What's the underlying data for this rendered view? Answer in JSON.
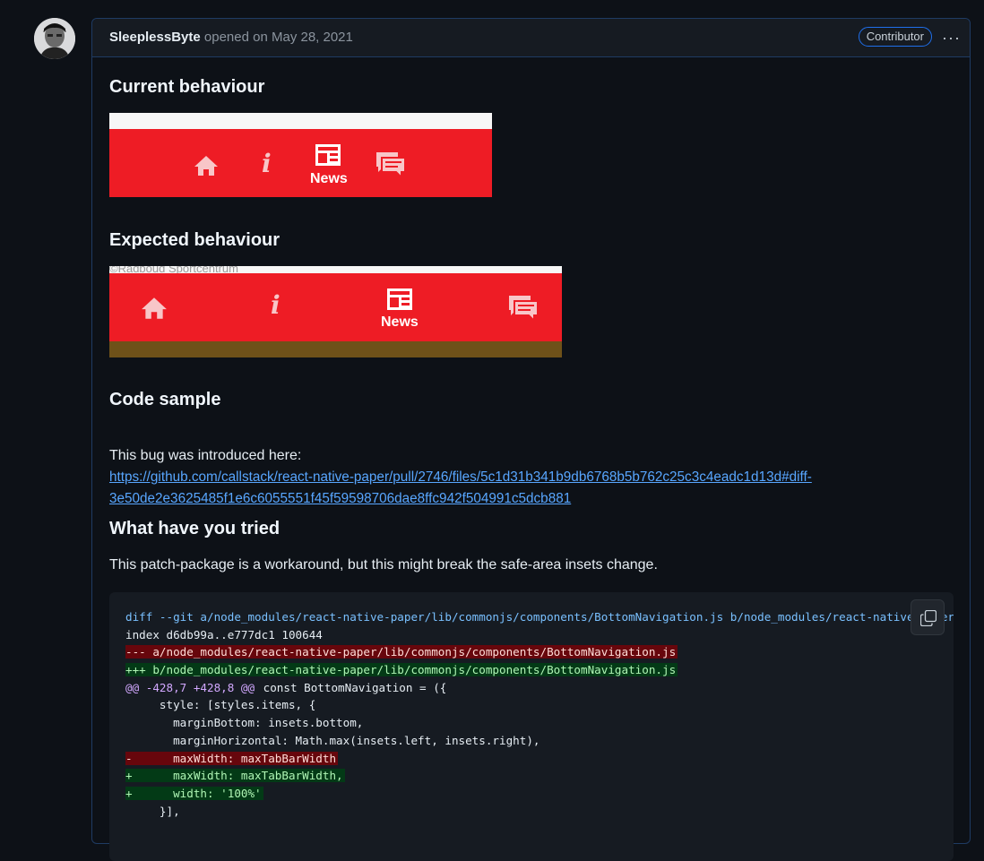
{
  "comment": {
    "author": "SleeplessByte",
    "action_text": " opened on May 28, 2021",
    "badge": "Contributor",
    "menu_glyph": "···"
  },
  "sections": {
    "current": "Current behaviour",
    "expected": "Expected behaviour",
    "code_sample": "Code sample",
    "tried": "What have you tried"
  },
  "screenshots": {
    "news_label": "News",
    "info_glyph": "i",
    "watermark": "©Radboud Sportcentrum",
    "brand_red": "#ee1c25"
  },
  "paragraphs": {
    "introduced": "This bug was introduced here:",
    "link_line1": "https://github.com/callstack/react-native-paper/pull/2746/files/5c1d31b341b9db6768b5b762c25c3c4eadc1d13d#diff-",
    "link_line2": "3e50de2e3625485f1e6c6055551f45f59598706dae8ffc942f504991c5dcb881",
    "workaround": "This patch-package is a workaround, but this might break the safe-area insets change."
  },
  "code": {
    "lines": [
      {
        "kind": "meta",
        "text": "diff --git a/node_modules/react-native-paper/lib/commonjs/components/BottomNavigation.js b/node_modules/react-native-paper/lib/commonjs/components/BottomNavigation.js"
      },
      {
        "kind": "plain",
        "text": "index d6db99a..e777dc1 100644"
      },
      {
        "kind": "del",
        "text": "--- a/node_modules/react-native-paper/lib/commonjs/components/BottomNavigation.js"
      },
      {
        "kind": "add",
        "text": "+++ b/node_modules/react-native-paper/lib/commonjs/components/BottomNavigation.js"
      },
      {
        "kind": "hunk",
        "text": "@@ -428,7 +428,8 @@",
        "rest": " const BottomNavigation = ({"
      },
      {
        "kind": "plain",
        "text": "     style: [styles.items, {"
      },
      {
        "kind": "plain",
        "text": "       marginBottom: insets.bottom,"
      },
      {
        "kind": "plain",
        "text": "       marginHorizontal: Math.max(insets.left, insets.right),"
      },
      {
        "kind": "del",
        "text": "-      maxWidth: maxTabBarWidth"
      },
      {
        "kind": "add",
        "text": "+      maxWidth: maxTabBarWidth,"
      },
      {
        "kind": "add",
        "text": "+      width: '100%'"
      },
      {
        "kind": "plain",
        "text": "     }],"
      }
    ]
  }
}
